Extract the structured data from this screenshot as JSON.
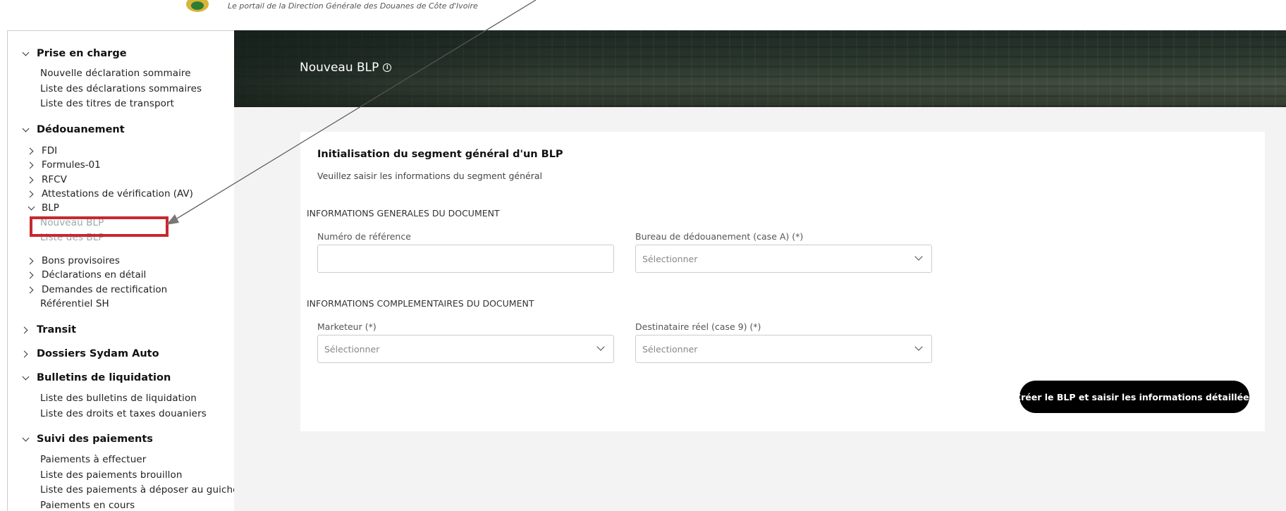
{
  "header": {
    "tagline": "Le portail de la Direction Générale des Douanes de Côte d'Ivoire"
  },
  "sidebar": {
    "prise_en_charge": {
      "title": "Prise en charge",
      "items": [
        "Nouvelle déclaration sommaire",
        "Liste des déclarations sommaires",
        "Liste des titres de transport"
      ]
    },
    "dedouanement": {
      "title": "Dédouanement",
      "sub": [
        "FDI",
        "Formules-01",
        "RFCV",
        "Attestations de vérification (AV)",
        "BLP"
      ],
      "blp_items": [
        "Nouveau BLP",
        "Liste des BLP"
      ],
      "sub2": [
        "Bons provisoires",
        "Déclarations en détail",
        "Demandes de rectification"
      ],
      "referentiel": "Référentiel SH"
    },
    "transit": {
      "title": "Transit"
    },
    "dossiers": {
      "title": "Dossiers Sydam Auto"
    },
    "bulletins": {
      "title": "Bulletins de liquidation",
      "items": [
        "Liste des bulletins de liquidation",
        "Liste des droits et taxes douaniers"
      ]
    },
    "paiements": {
      "title": "Suivi des paiements",
      "items": [
        "Paiements à effectuer",
        "Liste des paiements brouillon",
        "Liste des paiements à déposer au guichet",
        "Paiements en cours"
      ]
    }
  },
  "banner": {
    "title": "Nouveau BLP",
    "info_icon": "info-circle-icon"
  },
  "form": {
    "title": "Initialisation du segment général d'un BLP",
    "subtitle": "Veuillez saisir les informations du segment général",
    "section1": "INFORMATIONS GENERALES DU DOCUMENT",
    "ref_label": "Numéro de référence",
    "ref_value": "",
    "bureau_label": "Bureau de dédouanement (case A) (*)",
    "bureau_value": "Sélectionner",
    "section2": "INFORMATIONS COMPLEMENTAIRES DU DOCUMENT",
    "marketeur_label": "Marketeur (*)",
    "marketeur_value": "Sélectionner",
    "destinataire_label": "Destinataire réel (case 9) (*)",
    "destinataire_value": "Sélectionner",
    "submit_label": "Créer le BLP et saisir les informations détaillées"
  },
  "colors": {
    "accent": "#000000",
    "highlight": "#c8282e",
    "banner": "#2f3b32"
  }
}
